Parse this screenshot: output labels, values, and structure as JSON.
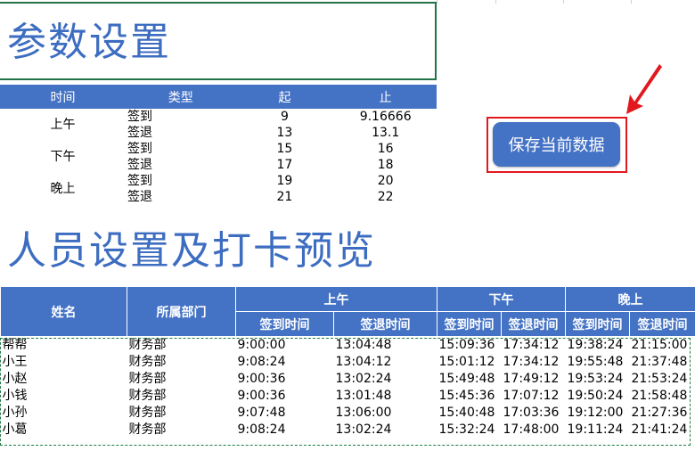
{
  "param_title": "参数设置",
  "param_table": {
    "headers": [
      "时间",
      "类型",
      "起",
      "止"
    ],
    "rows": [
      {
        "period": "上午",
        "type": "签到",
        "start": "9",
        "end": "9.16666"
      },
      {
        "period": "",
        "type": "签退",
        "start": "13",
        "end": "13.1"
      },
      {
        "period": "下午",
        "type": "签到",
        "start": "15",
        "end": "16"
      },
      {
        "period": "",
        "type": "签退",
        "start": "17",
        "end": "18"
      },
      {
        "period": "晚上",
        "type": "签到",
        "start": "19",
        "end": "20"
      },
      {
        "period": "",
        "type": "签退",
        "start": "21",
        "end": "22"
      }
    ]
  },
  "save_button": {
    "label": "保存当前数据",
    "highlight_color": "#e1181e"
  },
  "people_title": "人员设置及打卡预览",
  "people_table": {
    "col_name": "姓名",
    "col_dept": "所属部门",
    "groups": [
      "上午",
      "下午",
      "晚上"
    ],
    "sub": [
      "签到时间",
      "签退时间"
    ],
    "rows": [
      [
        "帮帮",
        "财务部",
        "9:00:00",
        "13:04:48",
        "15:09:36",
        "17:34:12",
        "19:38:24",
        "21:15:00"
      ],
      [
        "小王",
        "财务部",
        "9:08:24",
        "13:04:12",
        "15:01:12",
        "17:34:12",
        "19:55:48",
        "21:37:48"
      ],
      [
        "小赵",
        "财务部",
        "9:00:36",
        "13:02:24",
        "15:49:48",
        "17:49:12",
        "19:53:24",
        "21:53:24"
      ],
      [
        "小钱",
        "财务部",
        "9:00:36",
        "13:01:48",
        "15:45:36",
        "17:07:12",
        "19:50:24",
        "21:58:48"
      ],
      [
        "小孙",
        "财务部",
        "9:07:48",
        "13:06:00",
        "15:40:48",
        "17:03:36",
        "19:12:00",
        "21:27:36"
      ],
      [
        "小葛",
        "财务部",
        "9:08:24",
        "13:02:24",
        "15:32:24",
        "17:48:00",
        "19:11:24",
        "21:41:24"
      ]
    ]
  },
  "colors": {
    "header_blue": "#4472c4",
    "title_blue": "#3d6dc0",
    "selection_green": "#217346"
  }
}
